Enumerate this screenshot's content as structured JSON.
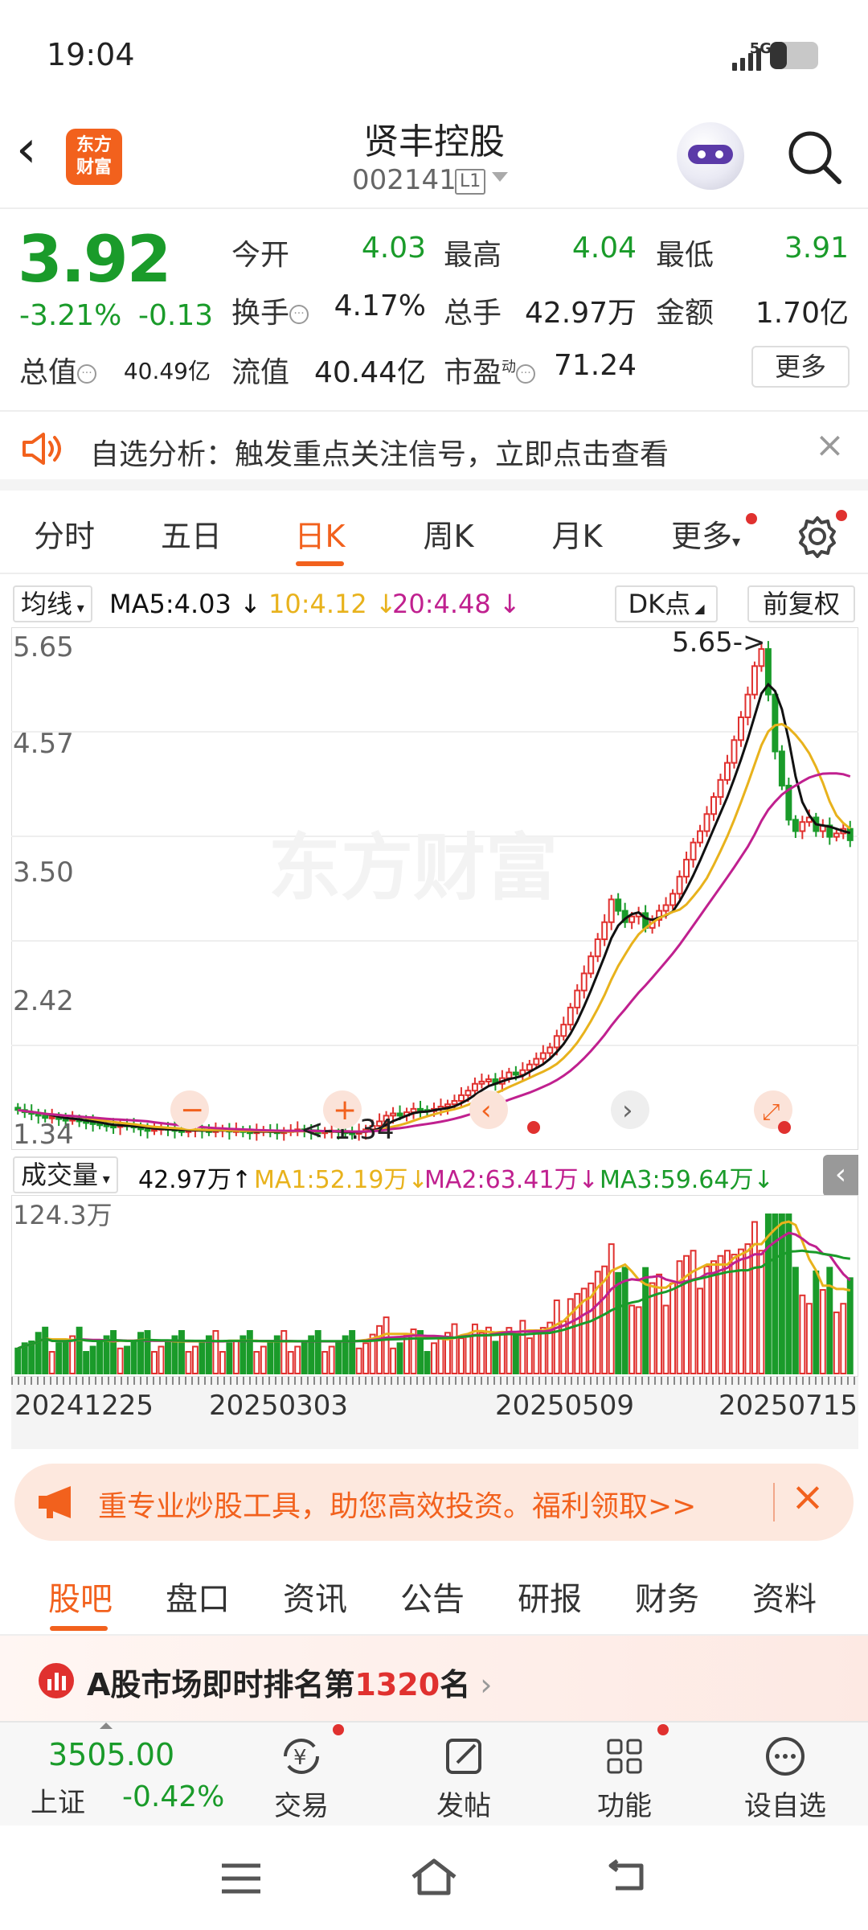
{
  "status": {
    "time": "19:04",
    "signal": "5G",
    "battery_level": 0.35
  },
  "header": {
    "logo": "东方财富",
    "name": "贤丰控股",
    "code": "002141",
    "level": "L1"
  },
  "quote": {
    "price": "3.92",
    "change_pct": "-3.21%",
    "change": "-0.13",
    "open_label": "今开",
    "open": "4.03",
    "high_label": "最高",
    "high": "4.04",
    "low_label": "最低",
    "low": "3.91",
    "turnover_label": "换手",
    "turnover": "4.17%",
    "volume_label": "总手",
    "volume": "42.97万",
    "amount_label": "金额",
    "amount": "1.70亿",
    "mktcap_label": "总值",
    "mktcap": "40.49亿",
    "float_label": "流值",
    "float": "40.44亿",
    "pe_label": "市盈",
    "pe_sup": "动",
    "pe": "71.24",
    "more": "更多"
  },
  "notice": {
    "text": "自选分析：触发重点关注信号，立即点击查看"
  },
  "chart_tabs": [
    "分时",
    "五日",
    "日K",
    "周K",
    "月K",
    "更多"
  ],
  "ma": {
    "selector": "均线",
    "ma5": "MA5:4.03",
    "ma10": "10:4.12",
    "ma20": "20:4.48",
    "dk": "DK点",
    "adjust": "前复权"
  },
  "colors": {
    "up": "#e0312f",
    "down": "#1a9b2a",
    "accent": "#f2611d",
    "ma5": "#111111",
    "ma10": "#e8b21c",
    "ma20": "#c0208f"
  },
  "chart_data": [
    {
      "type": "candlestick",
      "y_ticks": [
        "5.65",
        "4.57",
        "3.50",
        "2.42",
        "1.34"
      ],
      "ylim": [
        1.34,
        5.65
      ],
      "max_label": "5.65->",
      "min_label": "<-1.34",
      "watermark": "东方财富",
      "x_dates": [
        "20241225",
        "20250303",
        "20250509",
        "20250715"
      ],
      "close": [
        1.55,
        1.53,
        1.52,
        1.5,
        1.48,
        1.49,
        1.47,
        1.46,
        1.47,
        1.45,
        1.44,
        1.43,
        1.42,
        1.41,
        1.4,
        1.42,
        1.41,
        1.4,
        1.38,
        1.37,
        1.38,
        1.39,
        1.38,
        1.37,
        1.36,
        1.37,
        1.38,
        1.37,
        1.36,
        1.37,
        1.38,
        1.36,
        1.37,
        1.36,
        1.35,
        1.36,
        1.37,
        1.36,
        1.35,
        1.36,
        1.37,
        1.38,
        1.37,
        1.36,
        1.35,
        1.36,
        1.37,
        1.36,
        1.35,
        1.34,
        1.36,
        1.38,
        1.41,
        1.45,
        1.5,
        1.52,
        1.5,
        1.53,
        1.56,
        1.55,
        1.54,
        1.56,
        1.58,
        1.6,
        1.63,
        1.68,
        1.72,
        1.78,
        1.8,
        1.82,
        1.78,
        1.83,
        1.88,
        1.86,
        1.9,
        1.95,
        2.0,
        2.05,
        2.1,
        2.2,
        2.3,
        2.45,
        2.6,
        2.75,
        2.9,
        3.05,
        3.2,
        3.4,
        3.3,
        3.2,
        3.25,
        3.28,
        3.15,
        3.22,
        3.3,
        3.35,
        3.45,
        3.6,
        3.75,
        3.9,
        4.0,
        4.15,
        4.3,
        4.45,
        4.6,
        4.8,
        5.0,
        5.2,
        5.45,
        5.6,
        5.2,
        4.7,
        4.4,
        4.1,
        4.0,
        4.08,
        4.12,
        4.0,
        4.05,
        3.95,
        3.98,
        4.02,
        3.92
      ],
      "ma5_last": 4.03,
      "ma10_last": 4.12,
      "ma20_last": 4.48
    },
    {
      "type": "bar",
      "title": "成交量",
      "volume_label": "42.97万",
      "ma1": "MA1:52.19万",
      "ma2": "MA2:63.41万",
      "ma3": "MA3:59.64万",
      "y_tick": "124.3万",
      "ylim": [
        0,
        124.3
      ]
    }
  ],
  "promo": {
    "text": "重专业炒股工具，助您高效投资。福利领取>>"
  },
  "bottom_tabs": [
    "股吧",
    "盘口",
    "资讯",
    "公告",
    "研报",
    "财务",
    "资料"
  ],
  "rank": {
    "prefix": "A股市场即时排名第",
    "number": "1320",
    "suffix": "名"
  },
  "nav": {
    "index_value": "3505.00",
    "index_name": "上证",
    "index_change": "-0.42%",
    "trade": "交易",
    "post": "发帖",
    "function": "功能",
    "add": "设自选"
  }
}
